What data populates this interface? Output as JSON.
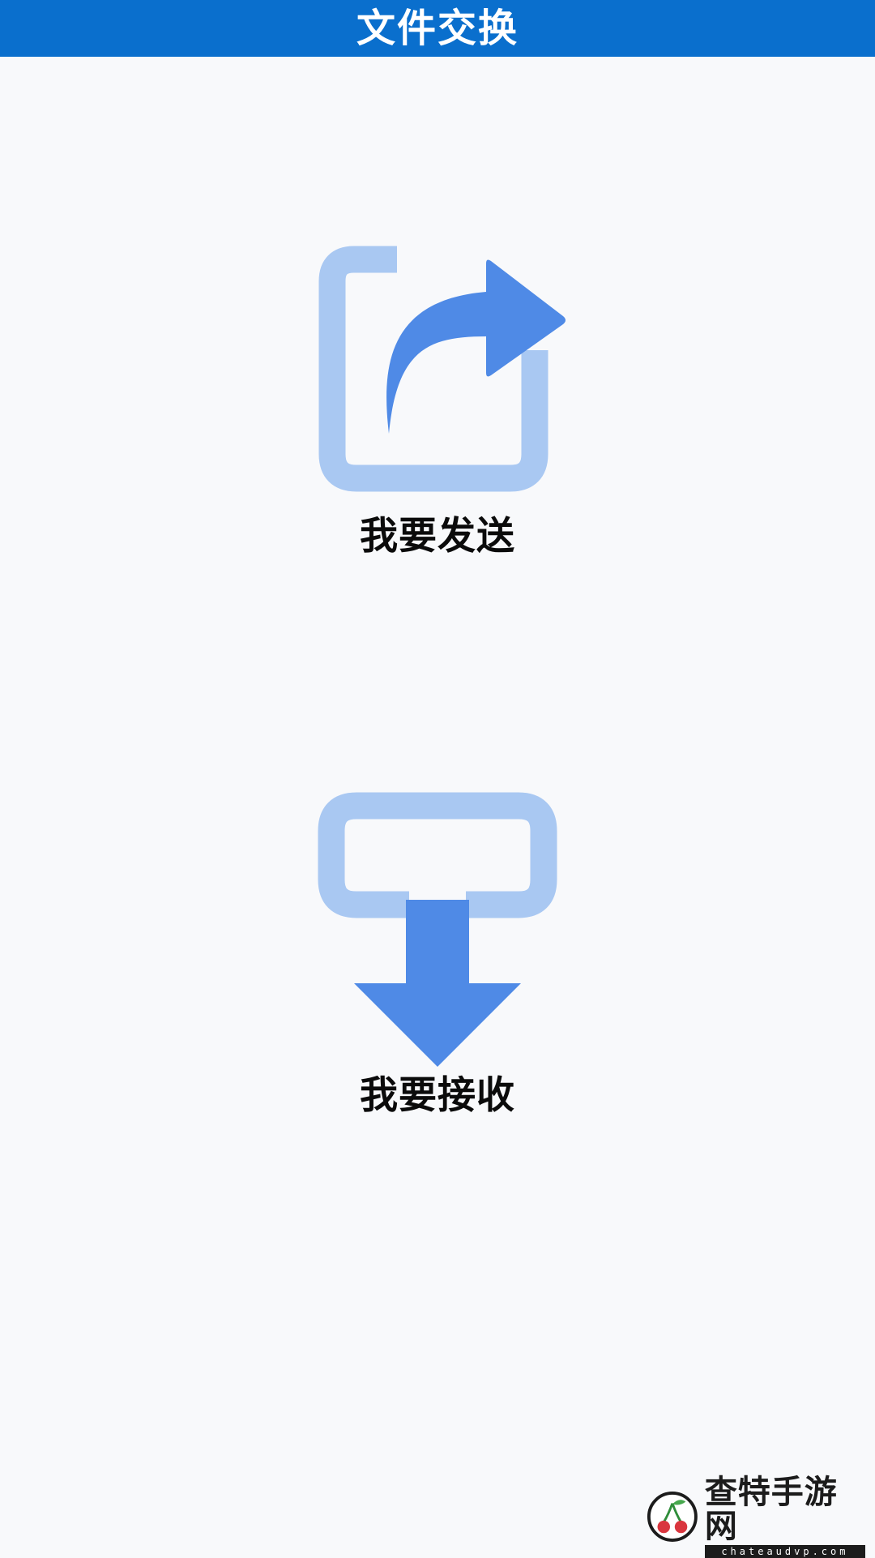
{
  "app_bar": {
    "title": "文件交换"
  },
  "actions": {
    "send": {
      "label": "我要发送",
      "icon": "share-forward-icon"
    },
    "receive": {
      "label": "我要接收",
      "icon": "download-tray-icon"
    }
  },
  "colors": {
    "app_bar": "#0a6fcd",
    "icon_primary": "#4f8ae6",
    "icon_secondary": "#a9c8f2",
    "background": "#f8f9fb"
  },
  "watermark": {
    "name": "查特手游网",
    "url": "chateaudvp.com",
    "icon": "cherry-logo-icon"
  }
}
